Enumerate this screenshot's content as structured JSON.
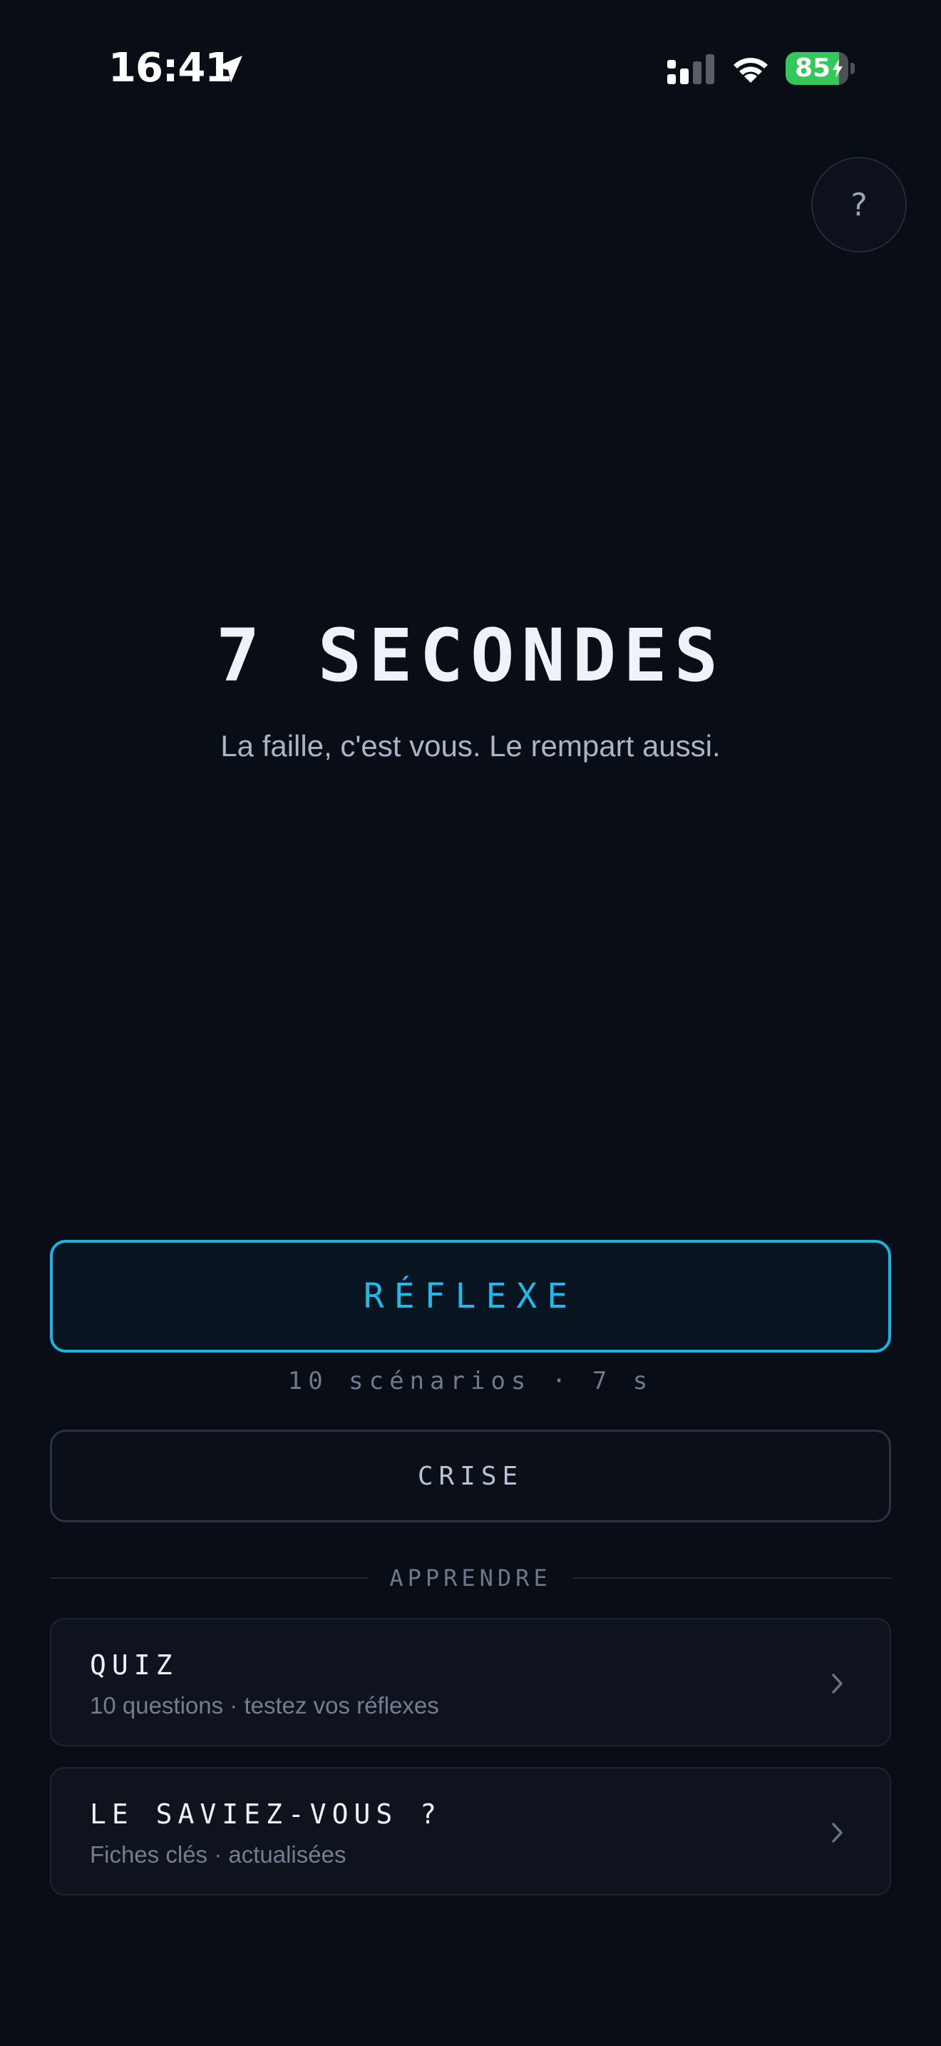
{
  "status_bar": {
    "time": "16:41",
    "battery_percent": "85",
    "battery_level": 0.85,
    "icons": [
      "location-arrow-icon",
      "cellular-signal-icon",
      "wifi-icon",
      "battery-charging-icon"
    ]
  },
  "help": {
    "label": "?"
  },
  "hero": {
    "title": "7 SECONDES",
    "subtitle": "La faille, c'est vous. Le rempart aussi."
  },
  "modes": {
    "reflexe": {
      "label": "RÉFLEXE",
      "caption": "10 scénarios · 7 s"
    },
    "crise": {
      "label": "CRISE"
    }
  },
  "learn": {
    "section_label": "APPRENDRE",
    "items": [
      {
        "title": "QUIZ",
        "subtitle": "10 questions · testez vos réflexes"
      },
      {
        "title": "LE SAVIEZ-VOUS ?",
        "subtitle": "Fiches clés · actualisées"
      }
    ]
  },
  "colors": {
    "background": "#090d16",
    "accent": "#21b8ea",
    "battery_green": "#34c759"
  }
}
